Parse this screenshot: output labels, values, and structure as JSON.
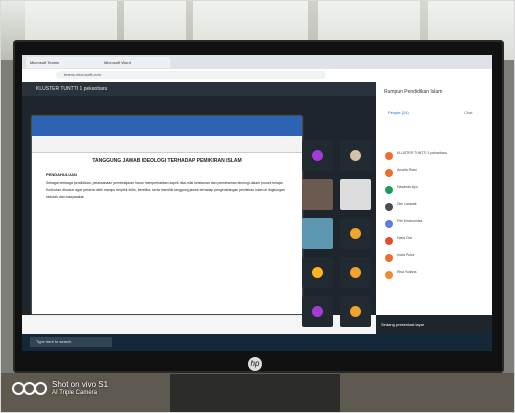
{
  "browser": {
    "tabs": [
      "Microsoft Teams",
      "Microsoft Word"
    ],
    "address": "teams.microsoft.com"
  },
  "meeting": {
    "top_title": "KLUSTER TUNTTI 1 pekanbaru",
    "caption": "Sedang presentasi layar",
    "side_title": "Rumpun Pendidikan Islam",
    "tabs": [
      "People (24)",
      "Chat"
    ],
    "participants": [
      {
        "name": "KLUSTER TUNTTI 1 pekanbaru",
        "color": "#f26b2c"
      },
      {
        "name": "Amalia Riani",
        "color": "#f26b2c"
      },
      {
        "name": "Hasanah Ayu",
        "color": "#1a9c5b"
      },
      {
        "name": "Dini Larasati",
        "color": "#4c4c4c"
      },
      {
        "name": "Fitri Khairunnisa",
        "color": "#5f7de0"
      },
      {
        "name": "Haris Dwi",
        "color": "#e44b2c"
      },
      {
        "name": "Indra Putra",
        "color": "#f26b2c"
      },
      {
        "name": "Risa Yuliana",
        "color": "#f08a2c"
      }
    ]
  },
  "document": {
    "title": "TANGGUNG JAWAB IDEOLOGI TERHADAP PEMIKIRAN ISLAM",
    "section": "PENDAHULUAN",
    "paragraph": "Sebagai lembaga pendidikan, pelaksanaan pembelajaran harus memperhatikan aspek nilai-nilai keislaman dan pemahaman ideologi dalam proses belajar. Kurikulum disusun agar peserta didik mampu berpikir kritis, beretika, serta memiliki tanggung jawab terhadap pengembangan pemikiran Islam di lingkungan sekolah dan masyarakat."
  },
  "taskbar": {
    "search": "Type here to search"
  },
  "branding": {
    "monitor": "hp",
    "watermark_line1": "Shot on vivo S1",
    "watermark_line2": "AI Triple Camera"
  }
}
